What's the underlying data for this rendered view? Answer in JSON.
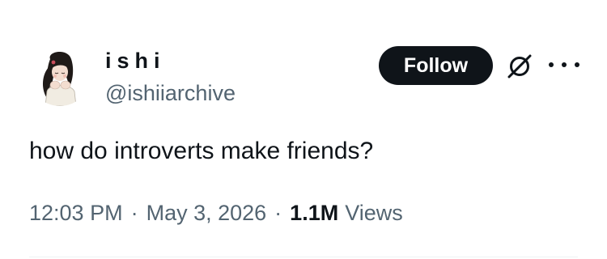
{
  "author": {
    "display_name": "ishi",
    "handle": "@ishiiarchive"
  },
  "actions": {
    "follow_label": "Follow",
    "grok_icon": "grok-icon",
    "more_icon": "more-icon"
  },
  "tweet": {
    "text": "how do introverts make friends?",
    "time": "12:03 PM",
    "separator": "·",
    "date": "May 3, 2026",
    "views_count": "1.1M",
    "views_label": "Views"
  },
  "colors": {
    "text_primary": "#0f1419",
    "text_secondary": "#536471",
    "button_bg": "#0f1419",
    "button_text": "#ffffff",
    "divider": "#eff3f4"
  }
}
